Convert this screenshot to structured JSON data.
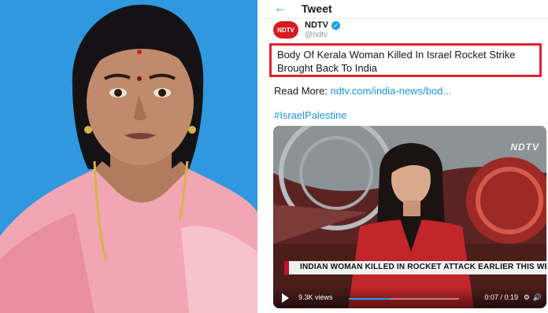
{
  "tweet": {
    "header_title": "Tweet",
    "back_icon": "arrow-left-icon",
    "author": {
      "avatar_text": "NDTV",
      "name": "NDTV",
      "handle": "@ndtv",
      "verified_icon": "verified-badge-icon"
    },
    "headline": "Body Of Kerala Woman Killed In Israel Rocket Strike Brought Back To India",
    "read_more_label": "Read More: ",
    "read_more_link": "ndtv.com/india-news/bod...",
    "hashtag": "#IsraelPalestine",
    "video": {
      "channel_logo": "NDTV",
      "lower_third": "INDIAN WOMAN KILLED IN ROCKET ATTACK EARLIER THIS WEEK",
      "view_count": "9.3K views",
      "time": "0:07 / 0:19",
      "progress": 0.37,
      "play_icon": "play-icon",
      "settings_icon": "gear-icon",
      "volume_icon": "volume-icon"
    }
  },
  "colors": {
    "accent": "#1da1f2",
    "highlight_box": "#e3222f",
    "brand_red": "#d71920",
    "photo_background": "#2f98df"
  }
}
